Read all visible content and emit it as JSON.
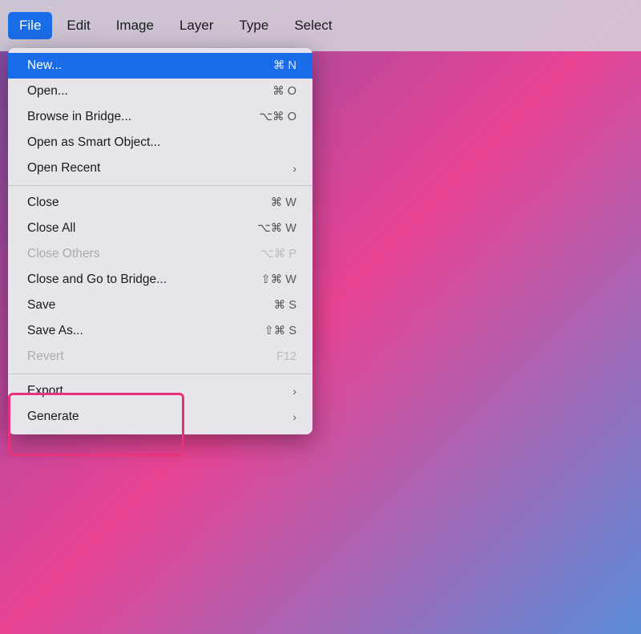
{
  "menubar": {
    "items": [
      {
        "label": "File",
        "active": true
      },
      {
        "label": "Edit",
        "active": false
      },
      {
        "label": "Image",
        "active": false
      },
      {
        "label": "Layer",
        "active": false
      },
      {
        "label": "Type",
        "active": false
      },
      {
        "label": "Select",
        "active": false
      }
    ]
  },
  "dropdown": {
    "items": [
      {
        "id": "new",
        "label": "New...",
        "shortcut": "⌘ N",
        "highlighted": true,
        "disabled": false,
        "has_arrow": false
      },
      {
        "id": "open",
        "label": "Open...",
        "shortcut": "⌘ O",
        "highlighted": false,
        "disabled": false,
        "has_arrow": false
      },
      {
        "id": "browse-bridge",
        "label": "Browse in Bridge...",
        "shortcut": "⌥⌘ O",
        "highlighted": false,
        "disabled": false,
        "has_arrow": false
      },
      {
        "id": "open-smart",
        "label": "Open as Smart Object...",
        "shortcut": "",
        "highlighted": false,
        "disabled": false,
        "has_arrow": false
      },
      {
        "id": "open-recent",
        "label": "Open Recent",
        "shortcut": "",
        "highlighted": false,
        "disabled": false,
        "has_arrow": true
      },
      {
        "id": "sep1",
        "type": "separator"
      },
      {
        "id": "close",
        "label": "Close",
        "shortcut": "⌘ W",
        "highlighted": false,
        "disabled": false,
        "has_arrow": false
      },
      {
        "id": "close-all",
        "label": "Close All",
        "shortcut": "⌥⌘ W",
        "highlighted": false,
        "disabled": false,
        "has_arrow": false
      },
      {
        "id": "close-others",
        "label": "Close Others",
        "shortcut": "⌥⌘ P",
        "highlighted": false,
        "disabled": true,
        "has_arrow": false
      },
      {
        "id": "close-bridge",
        "label": "Close and Go to Bridge...",
        "shortcut": "⇧⌘ W",
        "highlighted": false,
        "disabled": false,
        "has_arrow": false
      },
      {
        "id": "save",
        "label": "Save",
        "shortcut": "⌘ S",
        "highlighted": false,
        "disabled": false,
        "has_arrow": false
      },
      {
        "id": "save-as",
        "label": "Save As...",
        "shortcut": "⇧⌘ S",
        "highlighted": false,
        "disabled": false,
        "has_arrow": false
      },
      {
        "id": "revert",
        "label": "Revert",
        "shortcut": "F12",
        "highlighted": false,
        "disabled": true,
        "has_arrow": false
      },
      {
        "id": "sep2",
        "type": "separator"
      },
      {
        "id": "export",
        "label": "Export",
        "shortcut": "",
        "highlighted": false,
        "disabled": false,
        "has_arrow": true
      },
      {
        "id": "generate",
        "label": "Generate",
        "shortcut": "",
        "highlighted": false,
        "disabled": false,
        "has_arrow": true
      }
    ]
  }
}
